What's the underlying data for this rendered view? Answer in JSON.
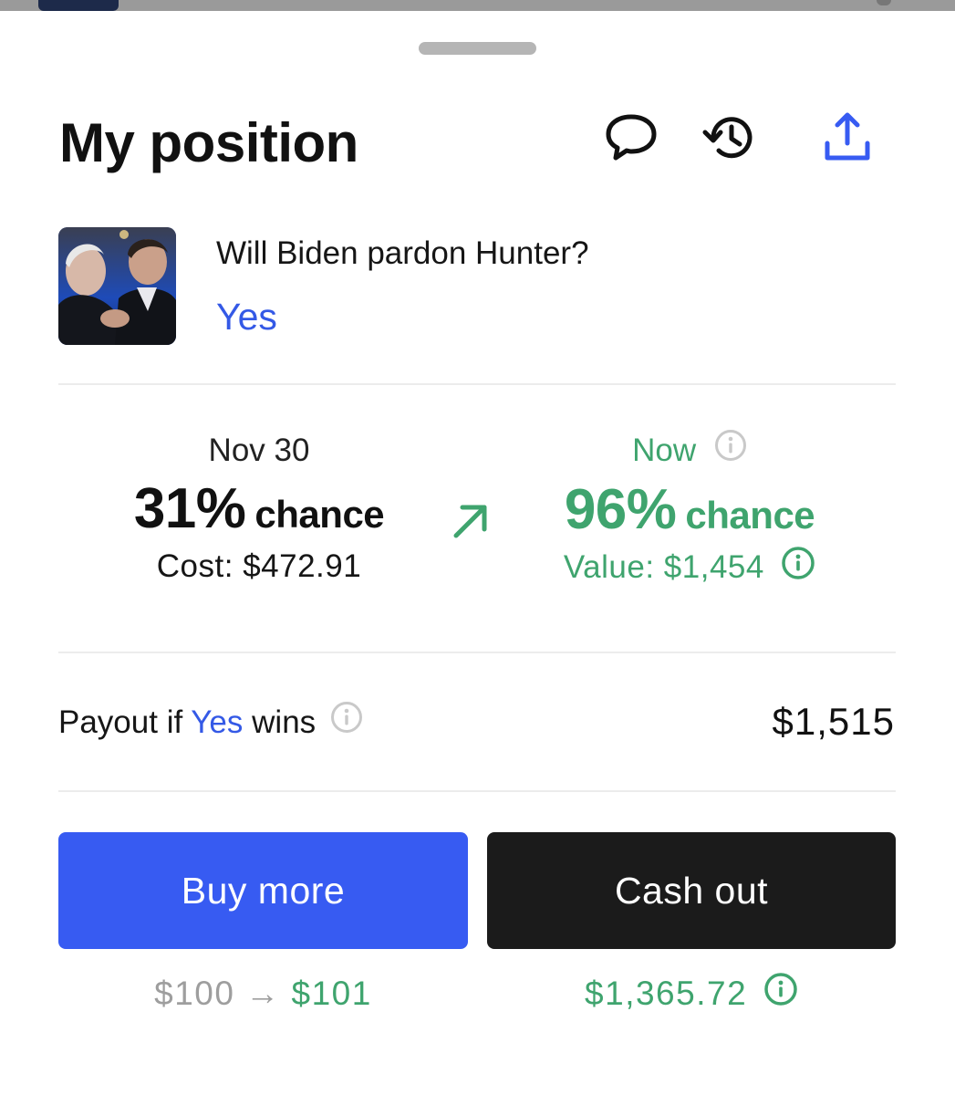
{
  "header": {
    "title": "My position"
  },
  "icons": {
    "comment": "speech-bubble",
    "history": "clock-counter",
    "share": "upload-share"
  },
  "market": {
    "question": "Will Biden pardon Hunter?",
    "side": "Yes",
    "image": "photo-two-men-embracing"
  },
  "compare": {
    "then": {
      "label": "Nov 30",
      "percent": "31%",
      "word": "chance",
      "detail": "Cost: $472.91"
    },
    "now": {
      "label": "Now",
      "percent": "96%",
      "word": "chance",
      "detail": "Value: $1,454"
    }
  },
  "payout": {
    "prefix": "Payout if",
    "side": "Yes",
    "suffix": "wins",
    "value": "$1,515"
  },
  "actions": {
    "buy": {
      "label": "Buy more",
      "from": "$100",
      "arrow": "→",
      "to": "$101"
    },
    "cash": {
      "label": "Cash out",
      "amount": "$1,365.72"
    }
  },
  "colors": {
    "accent_blue": "#375bf2",
    "green": "#3fa46e",
    "dark": "#1b1b1b",
    "muted": "#9e9e9e"
  }
}
